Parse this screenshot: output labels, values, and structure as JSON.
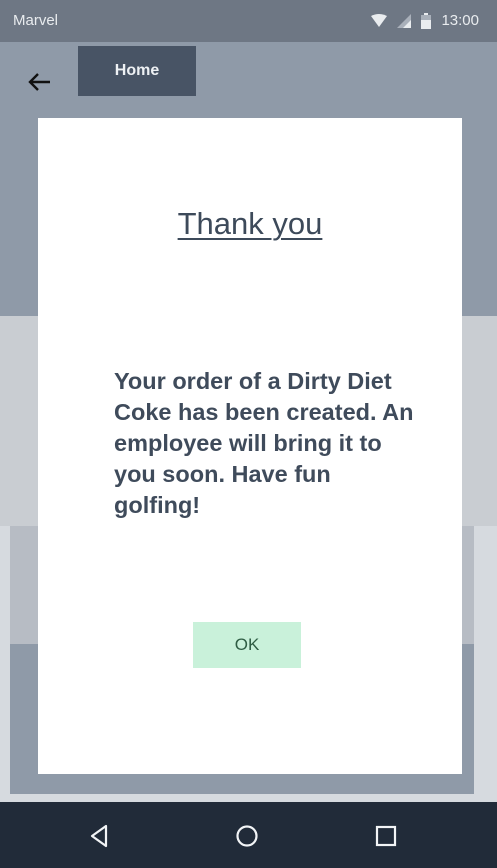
{
  "status_bar": {
    "app_name": "Marvel",
    "time": "13:00",
    "icons": [
      "wifi-icon",
      "signal-icon",
      "battery-icon"
    ]
  },
  "header": {
    "back_icon": "arrow-left-icon",
    "home_label": "Home"
  },
  "dialog": {
    "title": "Thank you",
    "message": "Your order of a Dirty Diet Coke has been created. An employee will bring it to you soon. Have fun golfing!",
    "ok_label": "OK"
  },
  "nav_bar": {
    "icons": [
      "back-triangle-icon",
      "home-circle-icon",
      "recents-square-icon"
    ]
  },
  "colors": {
    "status_bar": "#6e7784",
    "header": "#8f9aa8",
    "home_button": "#485465",
    "ok_button": "#c9f1da",
    "nav_bar": "#212b39",
    "text": "#3f4b5b"
  }
}
